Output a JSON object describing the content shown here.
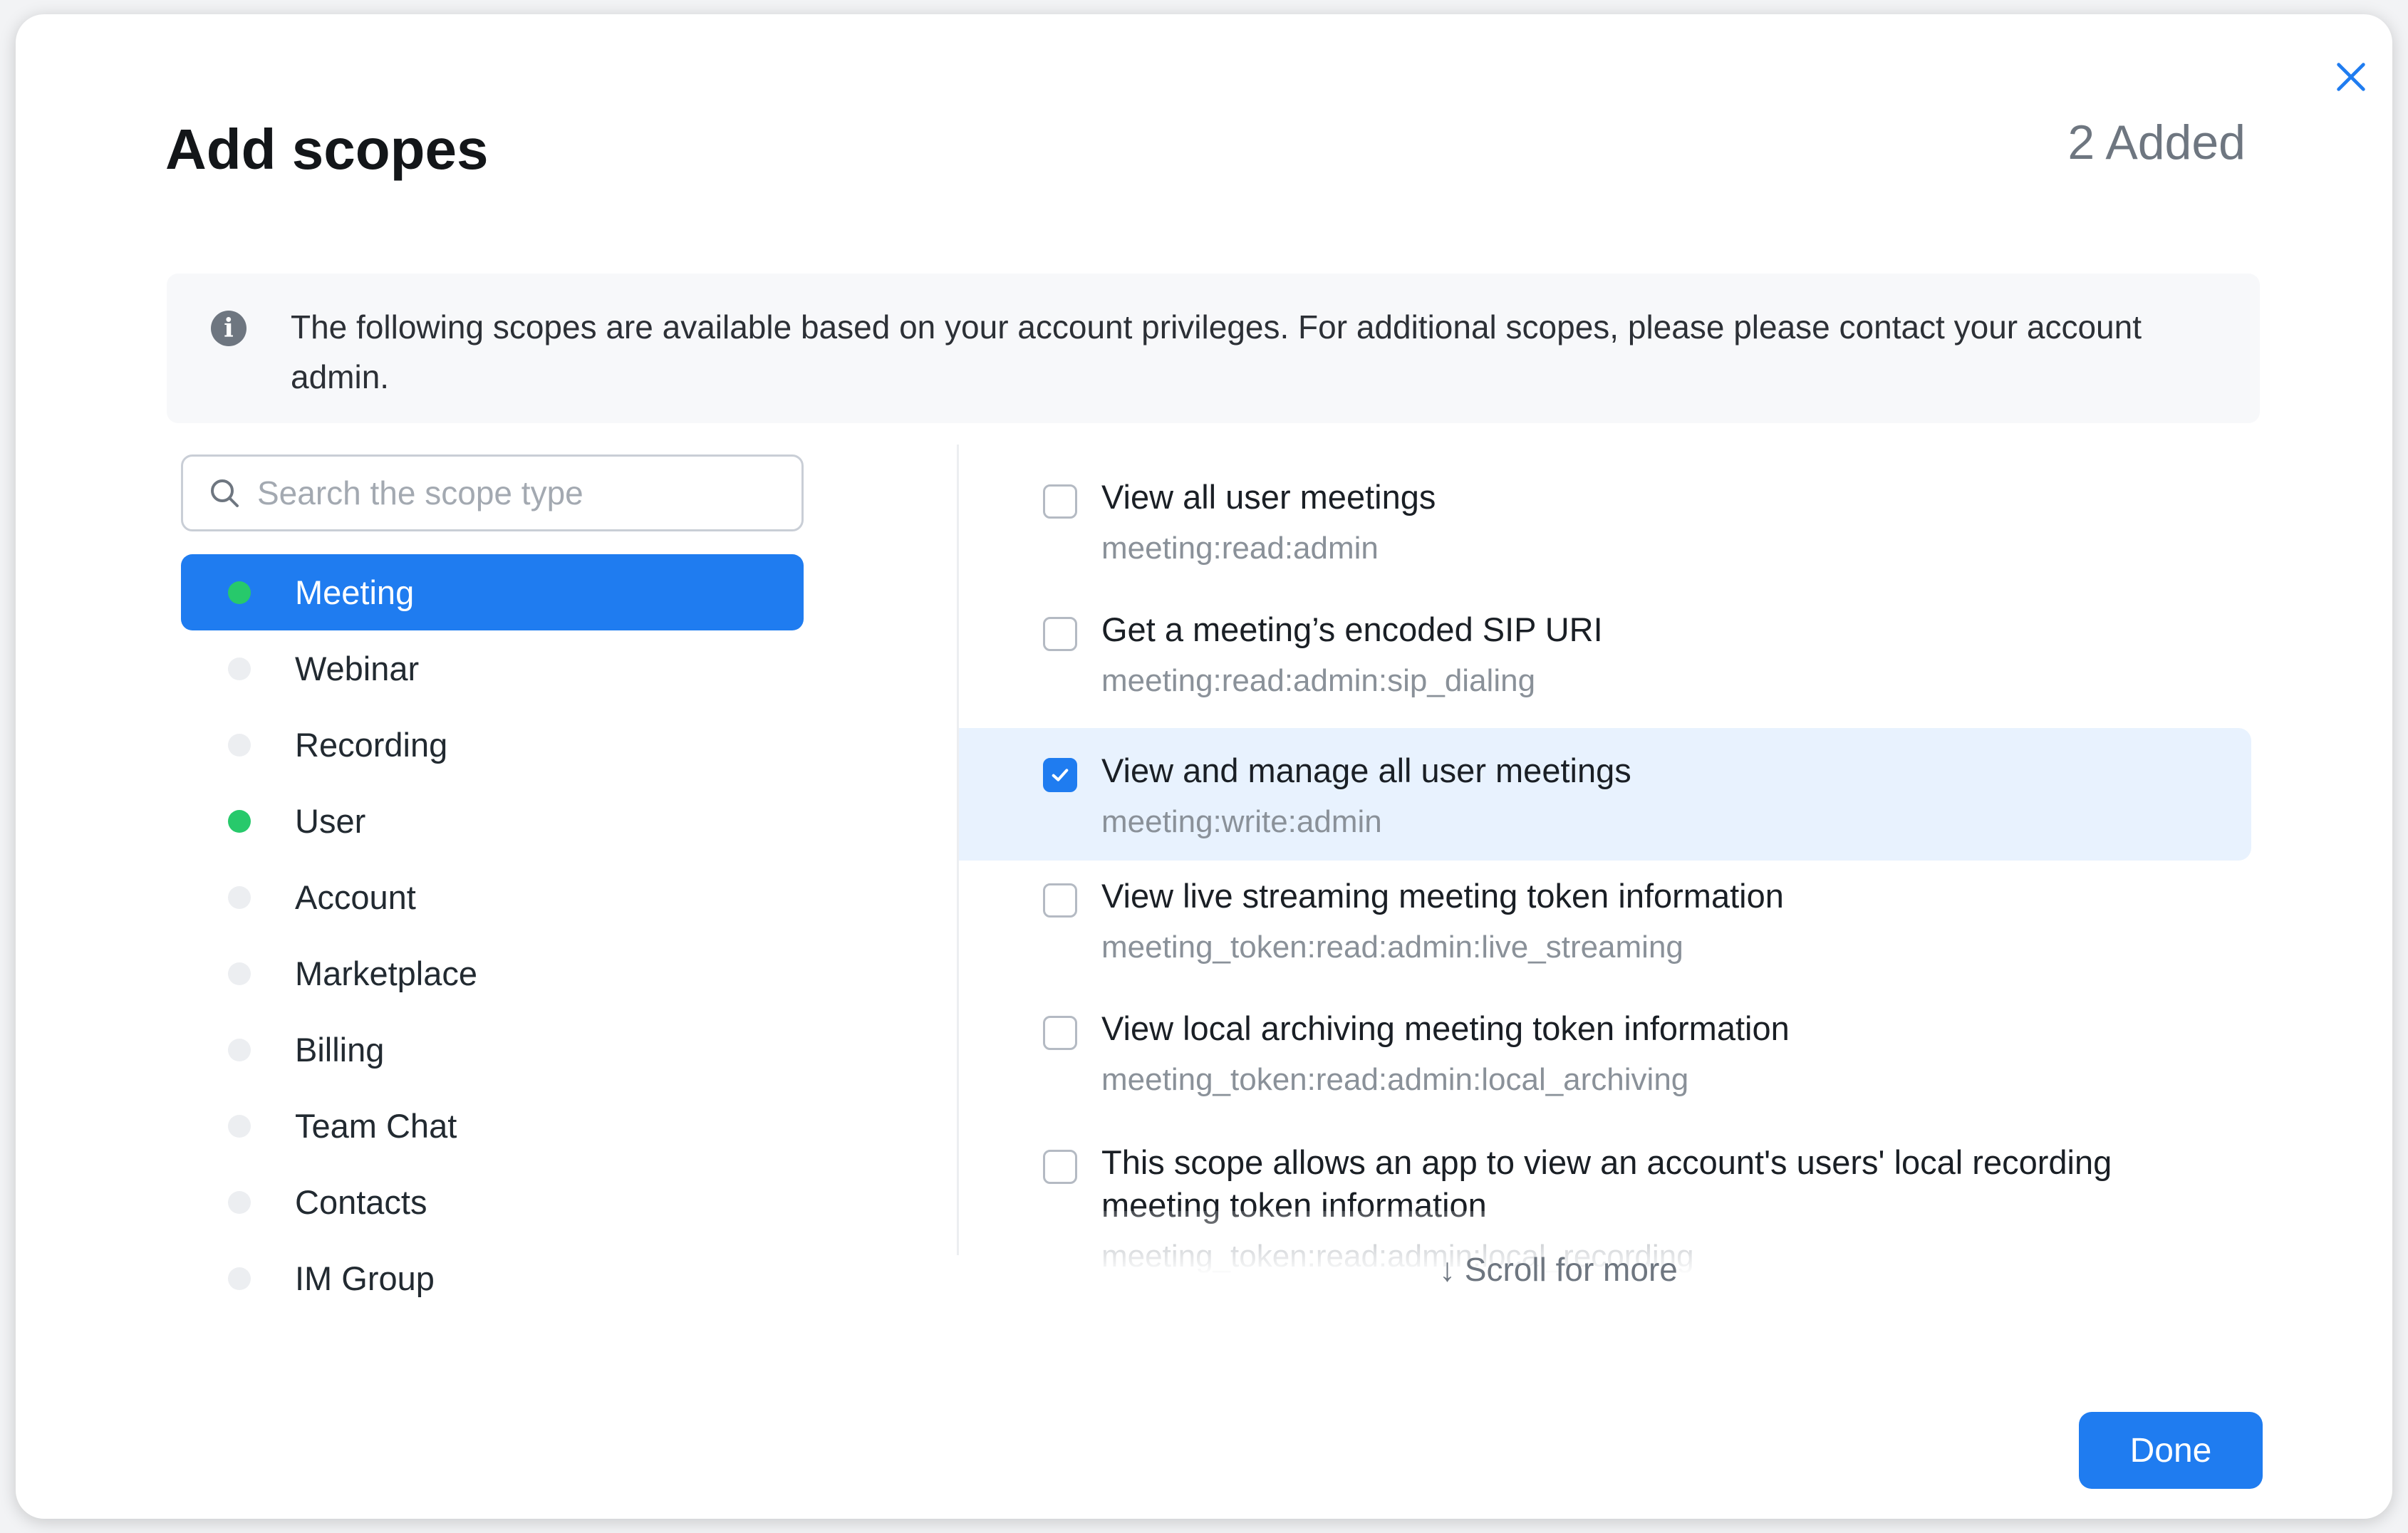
{
  "dialog": {
    "title": "Add scopes",
    "added_count": "2 Added",
    "info_text": "The following scopes are available based on your account privileges. For additional scopes, please please contact your account admin.",
    "search_placeholder": "Search the scope type",
    "scroll_hint": "↓ Scroll for more",
    "done_label": "Done"
  },
  "categories": [
    {
      "label": "Meeting",
      "has_selection": true,
      "active": true
    },
    {
      "label": "Webinar",
      "has_selection": false,
      "active": false
    },
    {
      "label": "Recording",
      "has_selection": false,
      "active": false
    },
    {
      "label": "User",
      "has_selection": true,
      "active": false
    },
    {
      "label": "Account",
      "has_selection": false,
      "active": false
    },
    {
      "label": "Marketplace",
      "has_selection": false,
      "active": false
    },
    {
      "label": "Billing",
      "has_selection": false,
      "active": false
    },
    {
      "label": "Team Chat",
      "has_selection": false,
      "active": false
    },
    {
      "label": "Contacts",
      "has_selection": false,
      "active": false
    },
    {
      "label": "IM Group",
      "has_selection": false,
      "active": false
    }
  ],
  "scopes": [
    {
      "name": "View all user meetings",
      "code": "meeting:read:admin",
      "checked": false
    },
    {
      "name": "Get a meeting’s encoded SIP URI",
      "code": "meeting:read:admin:sip_dialing",
      "checked": false
    },
    {
      "name": "View and manage all user meetings",
      "code": "meeting:write:admin",
      "checked": true
    },
    {
      "name": "View live streaming meeting token information",
      "code": "meeting_token:read:admin:live_streaming",
      "checked": false
    },
    {
      "name": "View local archiving meeting token information",
      "code": "meeting_token:read:admin:local_archiving",
      "checked": false
    },
    {
      "name": "This scope allows an app to view an account's users' local recording meeting token information",
      "code": "meeting_token:read:admin:local_recording",
      "checked": false
    }
  ],
  "colors": {
    "accent": "#1f7cf0",
    "selected_dot": "#27c96b",
    "selected_row_bg": "#e8f2fe"
  }
}
